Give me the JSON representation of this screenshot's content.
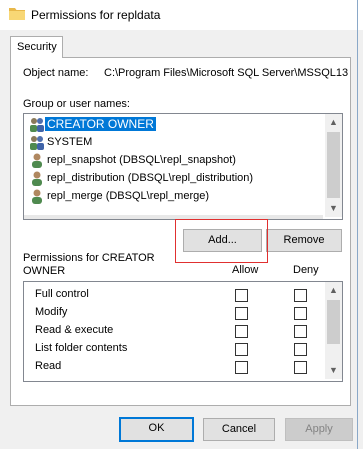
{
  "window": {
    "title": "Permissions for repldata"
  },
  "tabs": [
    {
      "label": "Security"
    }
  ],
  "object": {
    "label": "Object name:",
    "value": "C:\\Program Files\\Microsoft SQL Server\\MSSQL13."
  },
  "group_users": {
    "label": "Group or user names:",
    "items": [
      {
        "name": "CREATOR OWNER",
        "icon": "group-users-icon",
        "selected": true
      },
      {
        "name": "SYSTEM",
        "icon": "group-users-icon",
        "selected": false
      },
      {
        "name": "repl_snapshot (DBSQL\\repl_snapshot)",
        "icon": "user-icon",
        "selected": false
      },
      {
        "name": "repl_distribution (DBSQL\\repl_distribution)",
        "icon": "user-icon",
        "selected": false
      },
      {
        "name": "repl_merge (DBSQL\\repl_merge)",
        "icon": "user-icon",
        "selected": false
      }
    ]
  },
  "buttons": {
    "add": "Add...",
    "remove": "Remove",
    "ok": "OK",
    "cancel": "Cancel",
    "apply": "Apply"
  },
  "permissions": {
    "label": "Permissions for CREATOR OWNER",
    "allow_header": "Allow",
    "deny_header": "Deny",
    "rows": [
      {
        "name": "Full control",
        "allow": false,
        "deny": false
      },
      {
        "name": "Modify",
        "allow": false,
        "deny": false
      },
      {
        "name": "Read & execute",
        "allow": false,
        "deny": false
      },
      {
        "name": "List folder contents",
        "allow": false,
        "deny": false
      },
      {
        "name": "Read",
        "allow": false,
        "deny": false
      }
    ]
  },
  "colors": {
    "selection": "#0078d7",
    "highlight_box": "#e03030"
  }
}
